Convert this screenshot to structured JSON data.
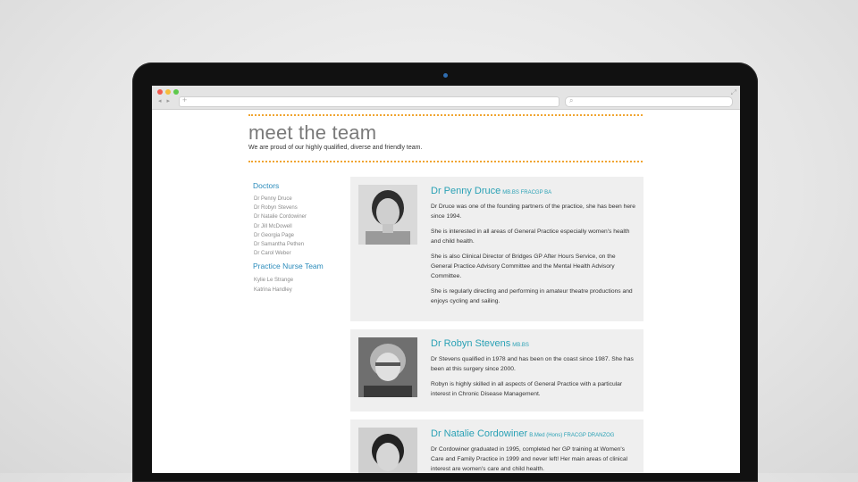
{
  "page": {
    "title": "meet the team",
    "subtitle": "We are proud of our highly qualified, diverse and friendly team."
  },
  "sidebar": {
    "doctors_heading": "Doctors",
    "doctors": [
      "Dr Penny Druce",
      "Dr Robyn Stevens",
      "Dr Natalie Cordowiner",
      "Dr Jill McDowell",
      "Dr Georgia Page",
      "Dr Samantha Pethen",
      "Dr Carol Weber"
    ],
    "nurses_heading": "Practice Nurse Team",
    "nurses": [
      "Kylie Le Strange",
      "Katrina Handley"
    ]
  },
  "profiles": [
    {
      "name": "Dr Penny Druce",
      "quals": "MB.BS FRACGP BA",
      "bio": [
        "Dr Druce was one of the founding partners of the practice, she has been here since 1994.",
        "She is interested in all areas of General Practice especially women's health and child health.",
        "She is also Clinical Director of Bridges GP After Hours Service, on the General Practice Advisory Committee and the Mental Health Advisory Committee.",
        "She is regularly directing and performing in amateur theatre productions and enjoys cycling and sailing."
      ]
    },
    {
      "name": "Dr Robyn Stevens",
      "quals": "MB.BS",
      "bio": [
        "Dr Stevens qualified in 1978 and has been on the coast since 1987. She has been at this surgery since 2000.",
        "Robyn is highly skilled in all aspects of General Practice with a particular interest in Chronic Disease Management."
      ]
    },
    {
      "name": "Dr Natalie Cordowiner",
      "quals": "B.Med (Hons) FRACGP DRANZOG",
      "bio": [
        "Dr Cordowiner graduated in 1995, completed her GP training at Women's Care and Family Practice in 1999 and never left! Her main areas of clinical interest are women's care and child health."
      ]
    }
  ],
  "colors": {
    "accent_link": "#2a8bbb",
    "name_teal": "#2aa1b5",
    "dotted_rule": "#f0a531",
    "card_bg": "#efefef"
  },
  "icons": {
    "window_controls": [
      "close-dot",
      "minimize-dot",
      "zoom-dot"
    ],
    "search": "search-icon",
    "expand": "expand-icon"
  }
}
